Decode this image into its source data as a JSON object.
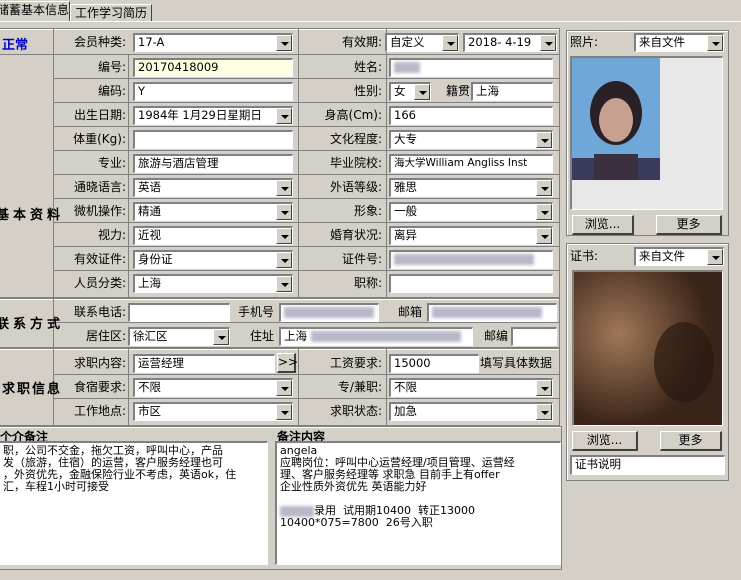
{
  "tabs": [
    "储蓄基本信息",
    "工作学习简历"
  ],
  "status": "正常",
  "sections": {
    "basic": "基本资料",
    "contact": "联系方式",
    "job": "求职信息"
  },
  "labels": {
    "member_type": "会员种类:",
    "valid_period": "有效期:",
    "number": "编号:",
    "name": "姓名:",
    "code": "编码:",
    "gender": "性别:",
    "native": "籍贯",
    "birth": "出生日期:",
    "height": "身高(Cm):",
    "weight": "体重(Kg):",
    "education": "文化程度:",
    "major": "专业:",
    "school": "毕业院校:",
    "language": "通晓语言:",
    "lang_level": "外语等级:",
    "computer": "微机操作:",
    "appearance": "形象:",
    "vision": "视力:",
    "marital": "婚育状况:",
    "id_type": "有效证件:",
    "id_no": "证件号:",
    "category": "人员分类:",
    "title": "职称:",
    "phone": "联系电话:",
    "mobile": "手机号",
    "email": "邮箱",
    "district": "居住区:",
    "address": "住址",
    "postcode": "邮编",
    "job_want": "求职内容:",
    "salary": "工资要求:",
    "meals": "食宿要求:",
    "fulltime": "专/兼职:",
    "location": "工作地点:",
    "job_status": "求职状态:",
    "photo": "照片:",
    "cert": "证书:"
  },
  "values": {
    "member_type": "17-A",
    "valid_mode": "自定义",
    "valid_date": "2018- 4-19",
    "number": "20170418009",
    "code": "Y",
    "gender": "女",
    "native": "上海",
    "birth": "1984年 1月29日星期日",
    "height": "166",
    "education": "大专",
    "major": "旅游与酒店管理",
    "school": "海大学William Angliss Inst",
    "language": "英语",
    "lang_level": "雅思",
    "computer": "精通",
    "appearance": "一般",
    "vision": "近视",
    "marital": "离异",
    "id_type": "身份证",
    "category": "上海",
    "district": "徐汇区",
    "address": "上海",
    "job_want": "运营经理",
    "salary": "15000",
    "salary_hint": "填写具体数据",
    "meals": "不限",
    "fulltime": "不限",
    "location": "市区",
    "job_status": "加急",
    "photo_src": "来自文件",
    "cert_src": "来自文件",
    "cert_desc": "证书说明"
  },
  "buttons": {
    "browse": "浏览...",
    "more": "更多",
    "go": ">>"
  },
  "memos": {
    "left_header": "个介备注",
    "left_text": "职，公司不交金，拖欠工资，呼叫中心，产品\n发（旅游，住宿）的运营，客户服务经理也可\n，外资优先，金融保险行业不考虑，英语ok，住\n汇，车程1小时可接受",
    "right_header": "备注内容",
    "right_text": "angela\n应聘岗位：呼叫中心运营经理/项目管理、运营经\n理、客户服务经理等 求职急 目前手上有offer\n企业性质外资优先 英语能力好",
    "right_text2": "录用  试用期10400  转正13000\n10400*075=7800  26号入职"
  },
  "colors": {
    "bg": "#d4d0c8",
    "accent": "#0000c8",
    "field": "#ffffff",
    "highlight": "#ffffe1"
  }
}
